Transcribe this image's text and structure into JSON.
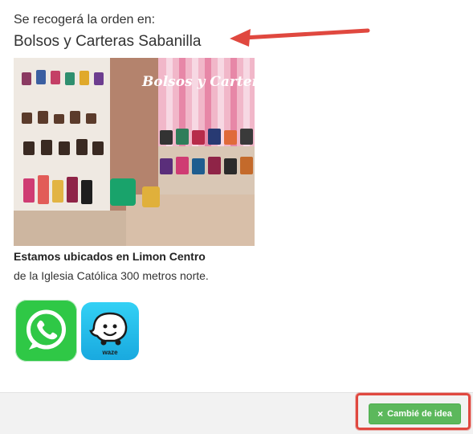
{
  "pickup": {
    "label": "Se recogerá la orden en:",
    "store_name": "Bolsos y Carteras Sabanilla"
  },
  "photo": {
    "sign_text": "Bolsos y Carteras"
  },
  "location": {
    "headline": "Estamos ubicados en Limon Centro",
    "detail": "de la Iglesia Católica 300 metros norte."
  },
  "apps": {
    "whatsapp_icon": "whatsapp-icon",
    "waze_icon": "waze-icon",
    "waze_label": "waze"
  },
  "footer": {
    "change_button_label": "Cambié de idea",
    "change_button_icon": "×"
  },
  "colors": {
    "annotation_red": "#e0483f",
    "button_green": "#5cb85c",
    "whatsapp_green": "#2fc846",
    "waze_blue": "#19a9df"
  }
}
